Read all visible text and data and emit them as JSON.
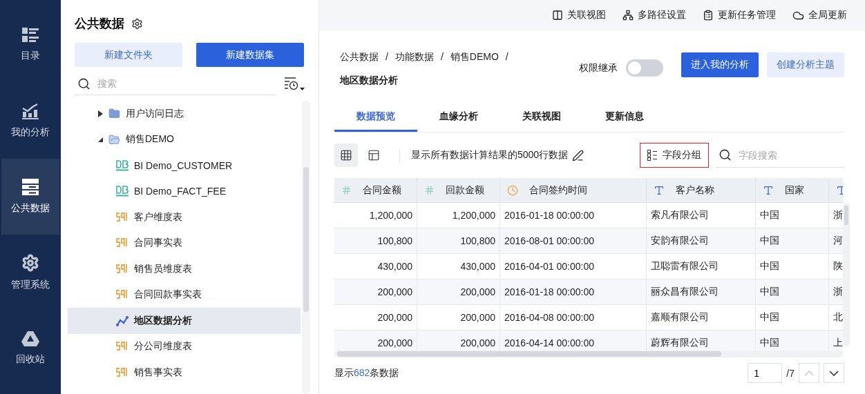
{
  "nav": [
    {
      "label": "目录",
      "kind": "catalog",
      "selected": false
    },
    {
      "label": "我的分析",
      "kind": "analysis",
      "selected": false
    },
    {
      "label": "公共数据",
      "kind": "public",
      "selected": true
    },
    {
      "label": "管理系统",
      "kind": "admin",
      "selected": false
    },
    {
      "label": "回收站",
      "kind": "trash",
      "selected": false
    }
  ],
  "panel": {
    "title": "公共数据",
    "buttons": [
      {
        "label": "新建文件夹",
        "kind": "secondary"
      },
      {
        "label": "新建数据集",
        "kind": "primary"
      }
    ],
    "search": {
      "placeholder": "搜索"
    },
    "tree": [
      {
        "label": "用户访问日志",
        "kind": "folder",
        "expanded": false,
        "selected": false
      },
      {
        "label": "销售DEMO",
        "kind": "folder",
        "expanded": true,
        "selected": false,
        "children": [
          {
            "label": "BI Demo_CUSTOMER",
            "kind": "db",
            "selected": false
          },
          {
            "label": "BI Demo_FACT_FEE",
            "kind": "db",
            "selected": false
          },
          {
            "label": "客户维度表",
            "kind": "sql",
            "selected": false
          },
          {
            "label": "合同事实表",
            "kind": "sql",
            "selected": false
          },
          {
            "label": "销售员维度表",
            "kind": "sql",
            "selected": false
          },
          {
            "label": "合同回款事实表",
            "kind": "sql",
            "selected": false
          },
          {
            "label": "地区数据分析",
            "kind": "analysis",
            "selected": true
          },
          {
            "label": "分公司维度表",
            "kind": "sql",
            "selected": false
          },
          {
            "label": "销售事实表",
            "kind": "sql",
            "selected": false
          }
        ]
      }
    ]
  },
  "toolbar": [
    {
      "label": "关联视图",
      "kind": "relation"
    },
    {
      "label": "多路径设置",
      "kind": "paths"
    },
    {
      "label": "更新任务管理",
      "kind": "tasks"
    },
    {
      "label": "全局更新",
      "kind": "update"
    }
  ],
  "breadcrumb": [
    {
      "label": "公共数据",
      "separator": "/"
    },
    {
      "label": "功能数据",
      "separator": "/"
    },
    {
      "label": "销售DEMO",
      "separator": "/"
    }
  ],
  "title": "地区数据分析",
  "permission": {
    "label": "权限继承",
    "on": false
  },
  "actions": [
    {
      "label": "进入我的分析",
      "kind": "primary"
    },
    {
      "label": "创建分析主题",
      "kind": "secondary"
    }
  ],
  "tabs": [
    {
      "label": "数据预览",
      "selected": true
    },
    {
      "label": "血缘分析",
      "selected": false
    },
    {
      "label": "关联视图",
      "selected": false
    },
    {
      "label": "更新信息",
      "selected": false
    }
  ],
  "view_modes": [
    {
      "kind": "grid",
      "selected": true
    },
    {
      "kind": "layout",
      "selected": false
    }
  ],
  "notice": "显示所有数据计算结果的5000行数据",
  "group_button": {
    "label": "字段分组",
    "highlighted": true
  },
  "field_search": {
    "placeholder": "字段搜索"
  },
  "table": {
    "columns": [
      {
        "label": "合同金额",
        "kind": "number"
      },
      {
        "label": "回款金额",
        "kind": "number"
      },
      {
        "label": "合同签约时间",
        "kind": "date"
      },
      {
        "label": "客户名称",
        "kind": "text"
      },
      {
        "label": "国家",
        "kind": "text"
      },
      {
        "kind": "text"
      }
    ],
    "rows": [
      [
        "1,200,000",
        "1,200,000",
        "2016-01-18 00:00:00",
        "索凡有限公司",
        "中国",
        "浙"
      ],
      [
        "100,800",
        "100,800",
        "2016-08-01 00:00:00",
        "安韵有限公司",
        "中国",
        "河"
      ],
      [
        "430,000",
        "430,000",
        "2016-04-01 00:00:00",
        "卫聪雷有限公司",
        "中国",
        "陕"
      ],
      [
        "200,000",
        "200,000",
        "2016-01-18 00:00:00",
        "丽众昌有限公司",
        "中国",
        "浙"
      ],
      [
        "200,000",
        "200,000",
        "2016-04-08 00:00:00",
        "嘉顺有限公司",
        "中国",
        "北"
      ],
      [
        "200,000",
        "200,000",
        "2016-04-14 00:00:00",
        "蔚辉有限公司",
        "中国",
        "上"
      ]
    ]
  },
  "footer": {
    "prefix": "显示",
    "count": "682",
    "suffix": "条数据"
  },
  "pager": {
    "page": "1",
    "total": "/7"
  }
}
